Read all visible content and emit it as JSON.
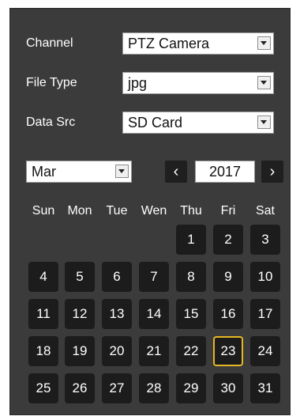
{
  "filters": {
    "channel": {
      "label": "Channel",
      "value": "PTZ Camera"
    },
    "file_type": {
      "label": "File Type",
      "value": "jpg"
    },
    "data_src": {
      "label": "Data Src",
      "value": "SD Card"
    }
  },
  "calendar": {
    "month": "Mar",
    "year": "2017",
    "prev_label": "‹",
    "next_label": "›",
    "weekdays": [
      "Sun",
      "Mon",
      "Tue",
      "Wen",
      "Thu",
      "Fri",
      "Sat"
    ],
    "first_weekday_index": 4,
    "days_in_month": 31,
    "highlighted_day": 23,
    "highlight_color": "#e6b625"
  },
  "icons": {
    "dropdown": "chevron-down-icon",
    "prev": "chevron-left-icon",
    "next": "chevron-right-icon"
  }
}
